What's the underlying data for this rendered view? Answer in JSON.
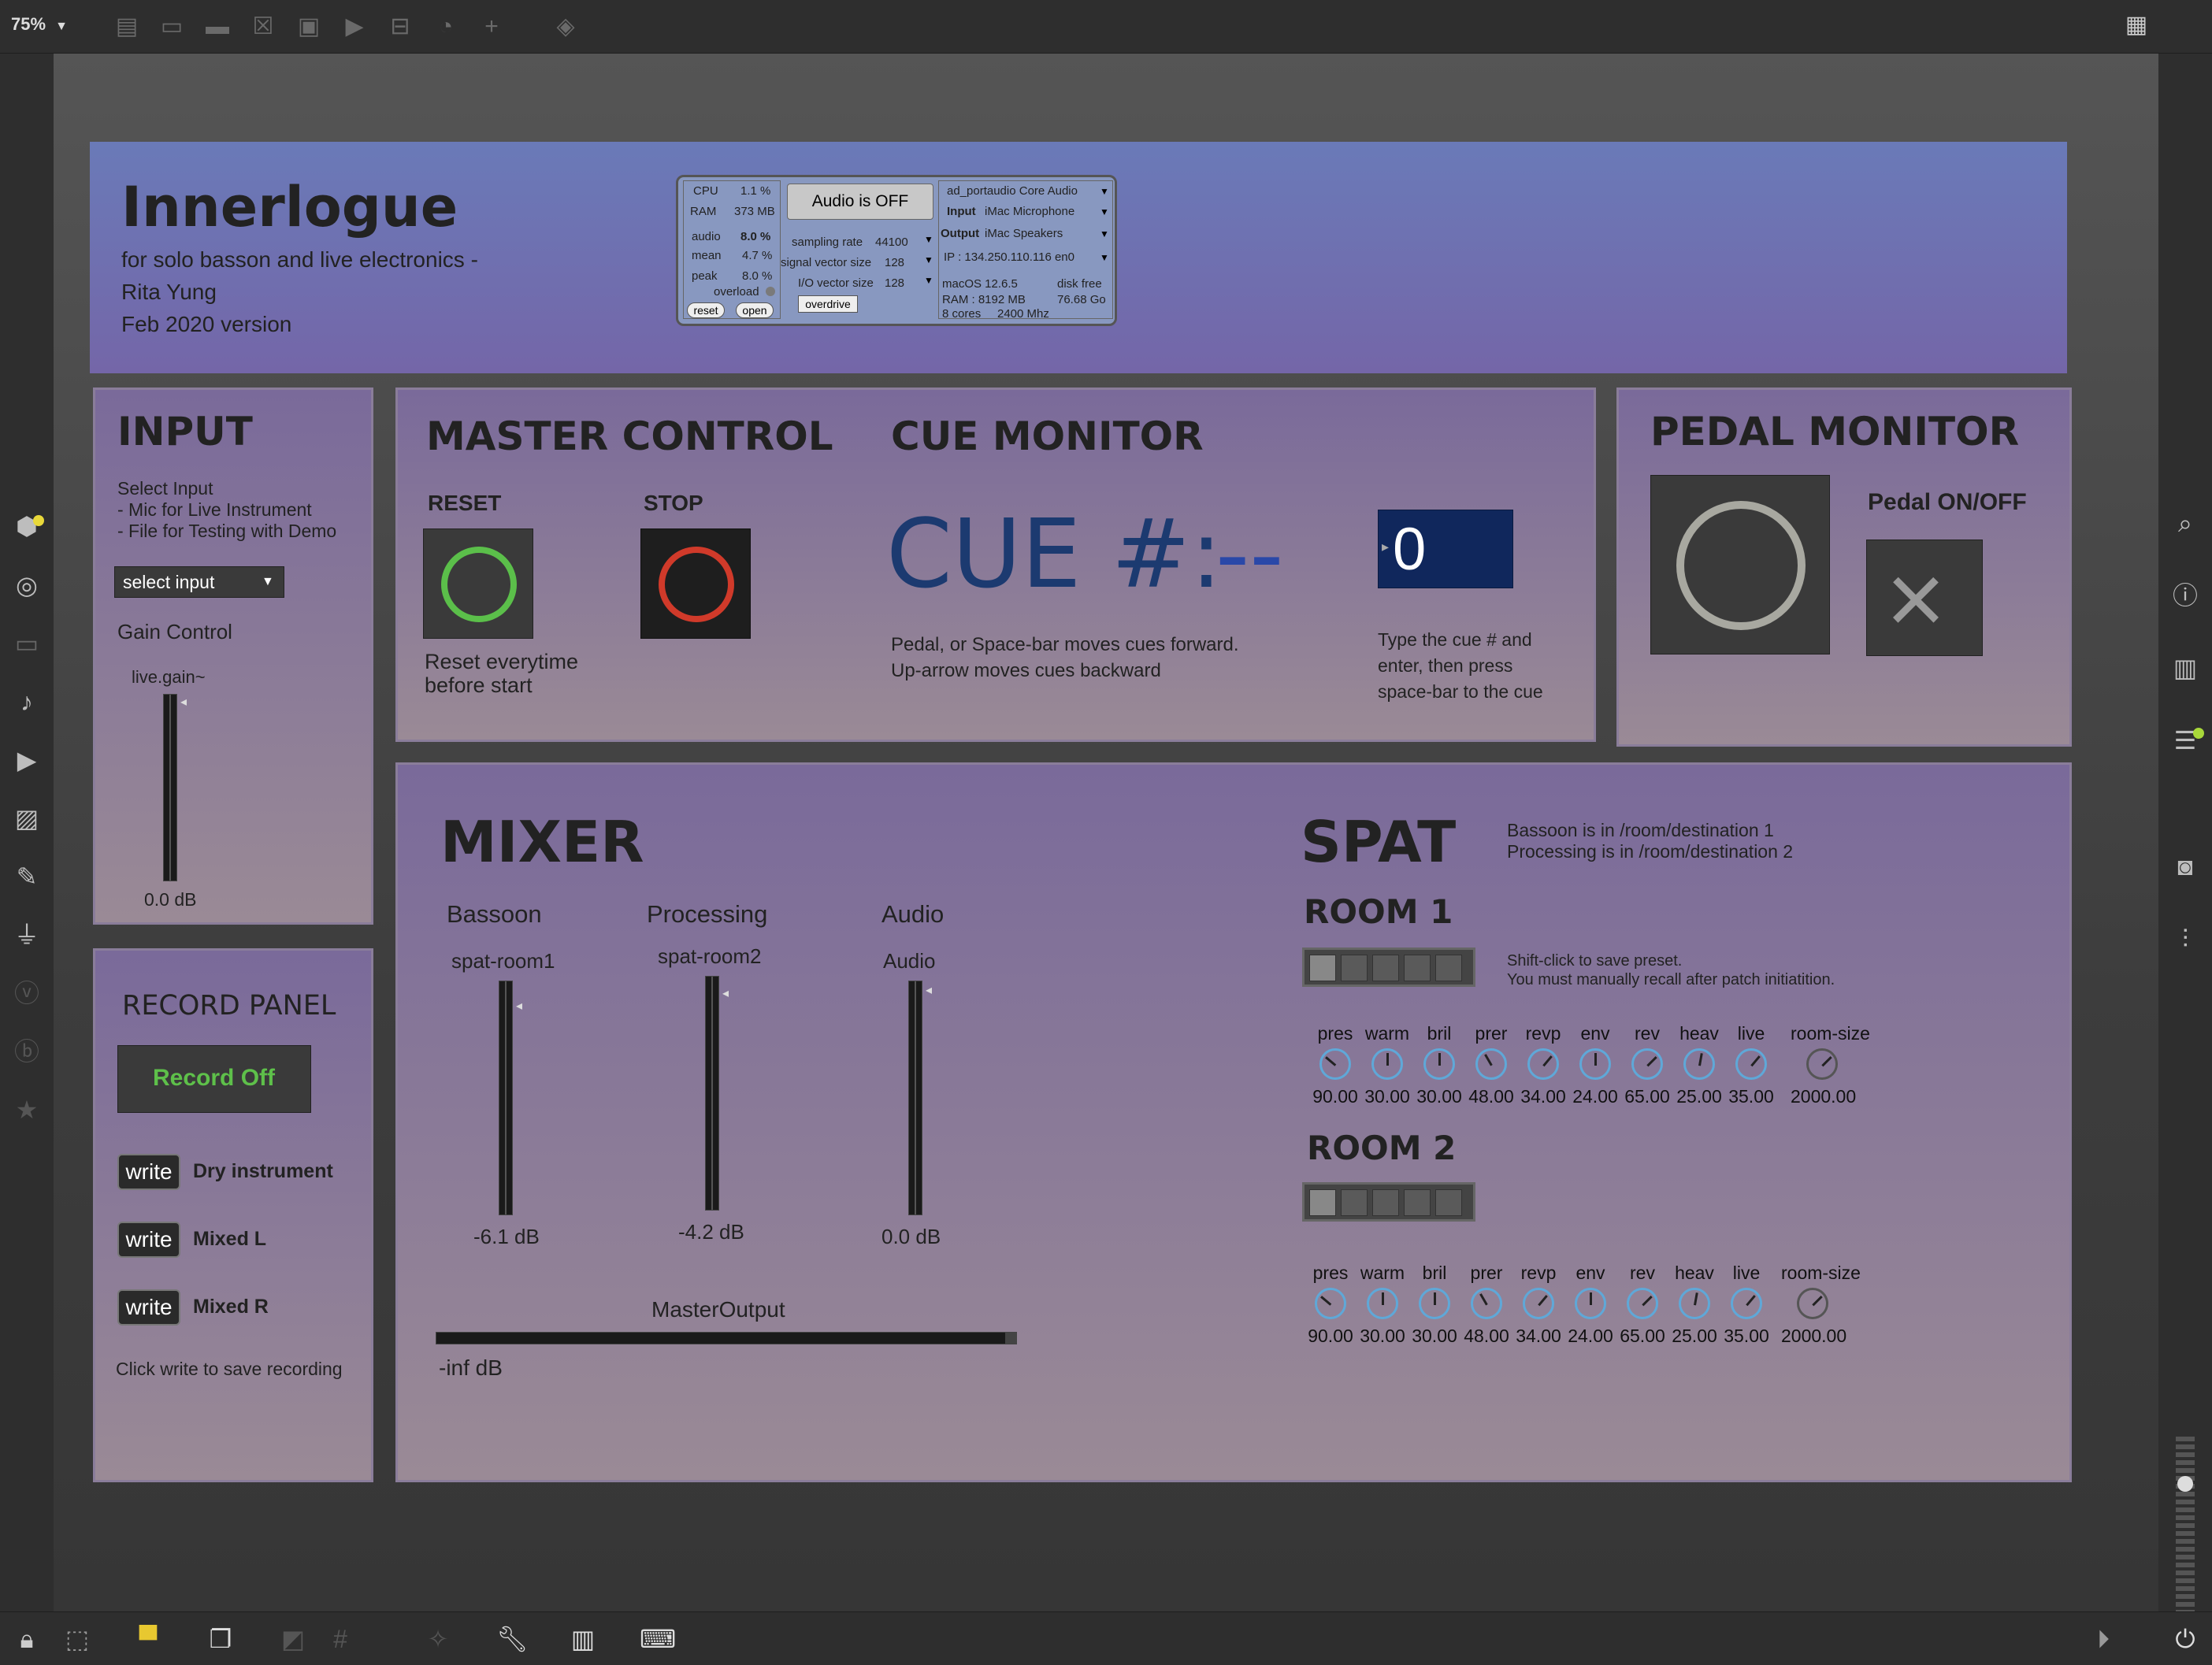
{
  "toolbar": {
    "zoom": "75%",
    "icons": [
      "new-object-icon",
      "message-icon",
      "comment-icon",
      "button-icon",
      "toggle-icon",
      "number-icon",
      "slider-icon",
      "dial-icon",
      "add-icon",
      "paint-bucket-icon"
    ],
    "grid_icon": "grid-icon"
  },
  "header": {
    "title": "Innerlogue",
    "subtitle_line1": "for solo basson and live electronics -",
    "subtitle_line2": "Rita Yung",
    "subtitle_line3": "Feb 2020 version"
  },
  "dsp": {
    "cpu_label": "CPU",
    "cpu_value": "1.1 %",
    "ram_label": "RAM",
    "ram_value": "373 MB",
    "audio_label": "audio",
    "audio_value": "8.0 %",
    "mean_label": "mean",
    "mean_value": "4.7 %",
    "peak_label": "peak",
    "peak_value": "8.0 %",
    "overload_label": "overload",
    "reset_label": "reset",
    "open_label": "open",
    "audio_toggle": "Audio is OFF",
    "sampling_rate_label": "sampling rate",
    "sampling_rate": "44100",
    "signal_vector_label": "signal vector size",
    "signal_vector": "128",
    "io_vector_label": "I/O vector size",
    "io_vector": "128",
    "overdrive_label": "overdrive",
    "driver": "ad_portaudio Core Audio",
    "input_label": "Input",
    "input_device": "iMac Microphone",
    "output_label": "Output",
    "output_device": "iMac Speakers",
    "ip": "IP : 134.250.110.116  en0",
    "os": "macOS 12.6.5",
    "disk_label": "disk free",
    "ram_total": "RAM : 8192 MB",
    "disk_free": "76.68 Go",
    "cores": "8 cores",
    "clock": "2400 Mhz"
  },
  "input": {
    "title": "INPUT",
    "help1": "Select Input",
    "help2": "- Mic for Live Instrument",
    "help3": "- File for Testing with Demo",
    "select_label": "select input",
    "gain_label": "Gain Control",
    "gain_name": "live.gain~",
    "gain_value": "0.0 dB"
  },
  "record": {
    "title": "RECORD PANEL",
    "toggle_label": "Record Off",
    "rows": [
      {
        "button": "write",
        "label": "Dry instrument"
      },
      {
        "button": "write",
        "label": "Mixed L"
      },
      {
        "button": "write",
        "label": "Mixed R"
      }
    ],
    "help": "Click write to save recording"
  },
  "master": {
    "title": "MASTER CONTROL",
    "reset_label": "RESET",
    "stop_label": "STOP",
    "reset_help1": "Reset everytime",
    "reset_help2": "before start"
  },
  "cue": {
    "title": "CUE MONITOR",
    "cue_text": "CUE #:",
    "cue_value": "--",
    "number_box": "0",
    "help1": "Pedal, or Space-bar moves cues forward.",
    "help2": "Up-arrow moves cues backward",
    "num_help1": "Type the cue # and",
    "num_help2": "enter, then press",
    "num_help3": "space-bar to the cue"
  },
  "pedal": {
    "title": "PEDAL MONITOR",
    "toggle_label": "Pedal ON/OFF"
  },
  "mixer": {
    "title": "MIXER",
    "channels": [
      {
        "label": "Bassoon",
        "name": "spat-room1",
        "value": "-6.1 dB"
      },
      {
        "label": "Processing",
        "name": "spat-room2",
        "value": "-4.2 dB"
      },
      {
        "label": "Audio",
        "name": "Audio",
        "value": "0.0 dB"
      }
    ],
    "master_label": "MasterOutput",
    "master_value": "-inf dB"
  },
  "spat": {
    "title": "SPAT",
    "note1": "Bassoon is in /room/destination 1",
    "note2": "Processing is in /room/destination 2",
    "preset_help1": "Shift-click to save preset.",
    "preset_help2": "You must manually recall after patch initiatition.",
    "room1": {
      "title": "ROOM 1",
      "knobs": [
        {
          "label": "pres",
          "value": "90.00"
        },
        {
          "label": "warm",
          "value": "30.00"
        },
        {
          "label": "bril",
          "value": "30.00"
        },
        {
          "label": "prer",
          "value": "48.00"
        },
        {
          "label": "revp",
          "value": "34.00"
        },
        {
          "label": "env",
          "value": "24.00"
        },
        {
          "label": "rev",
          "value": "65.00"
        },
        {
          "label": "heav",
          "value": "25.00"
        },
        {
          "label": "live",
          "value": "35.00"
        },
        {
          "label": "room-size",
          "value": "2000.00"
        }
      ]
    },
    "room2": {
      "title": "ROOM 2",
      "knobs": [
        {
          "label": "pres",
          "value": "90.00"
        },
        {
          "label": "warm",
          "value": "30.00"
        },
        {
          "label": "bril",
          "value": "30.00"
        },
        {
          "label": "prer",
          "value": "48.00"
        },
        {
          "label": "revp",
          "value": "34.00"
        },
        {
          "label": "env",
          "value": "24.00"
        },
        {
          "label": "rev",
          "value": "65.00"
        },
        {
          "label": "heav",
          "value": "25.00"
        },
        {
          "label": "live",
          "value": "35.00"
        },
        {
          "label": "room-size",
          "value": "2000.00"
        }
      ]
    }
  }
}
